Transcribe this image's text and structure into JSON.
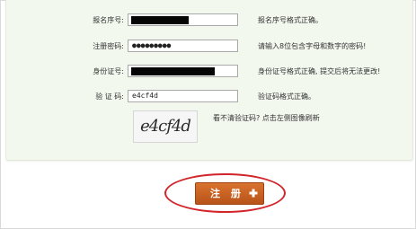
{
  "form": {
    "fields": [
      {
        "label": "报名序号:",
        "value": "",
        "masked": true,
        "hint": "报名序号格式正确。"
      },
      {
        "label": "注册密码:",
        "value": "●●●●●●●●●",
        "masked": false,
        "hint": "请输入8位包含字母和数字的密码!"
      },
      {
        "label": "身份证号:",
        "value": "",
        "masked": true,
        "hint": "身份证号格式正确, 提交后将无法更改!"
      },
      {
        "label": "验 证 码:",
        "value": "e4cf4d",
        "masked": false,
        "hint": "验证码格式正确。"
      }
    ],
    "captcha": {
      "text": "e4cf4d",
      "refresh_tip": "看不清验证码? 点击左侧图像刷新"
    }
  },
  "register_button": {
    "label": "注 册",
    "icon": "plus-icon"
  },
  "colors": {
    "panel_bg": "#f3f8ef",
    "button_bg": "#c9621f",
    "highlight_ring": "#d1242b"
  }
}
